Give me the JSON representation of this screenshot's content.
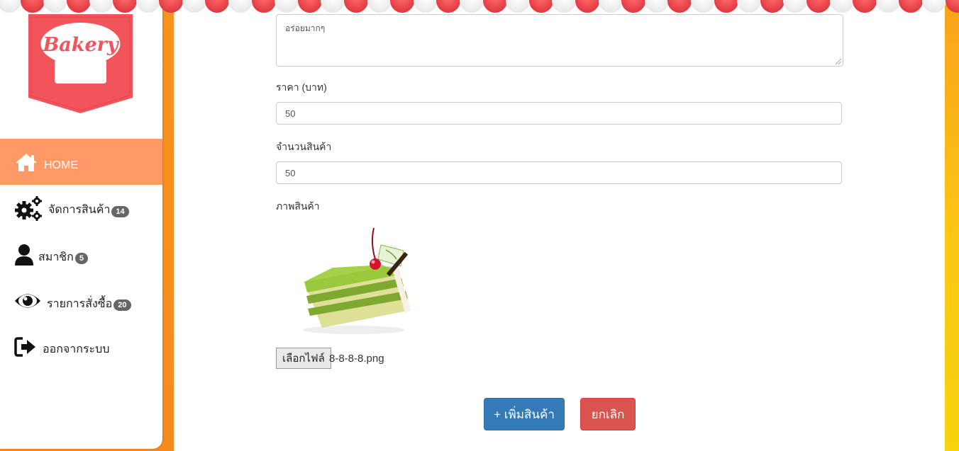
{
  "brand": {
    "logo_text": "Bakery",
    "logo_color": "#f2545b"
  },
  "colors": {
    "active_nav": "#ff9966",
    "add_button": "#337ab7",
    "cancel_button": "#d9534f",
    "badge": "#666666"
  },
  "sidebar": {
    "items": [
      {
        "label": "HOME",
        "icon": "home-icon",
        "badge": null
      },
      {
        "label": "จัดการสินค้า",
        "icon": "gears-icon",
        "badge": "14"
      },
      {
        "label": "สมาชิก",
        "icon": "user-icon",
        "badge": "5"
      },
      {
        "label": "รายการสั่งซื้อ",
        "icon": "eye-icon",
        "badge": "20"
      },
      {
        "label": "ออกจากระบบ",
        "icon": "sign-out-icon",
        "badge": null
      }
    ]
  },
  "form": {
    "detail_value": "อร่อยมากๆ",
    "price_label": "ราคา (บาท)",
    "price_value": "50",
    "qty_label": "จำนวนสินค้า",
    "qty_value": "50",
    "image_label": "ภาพสินค้า",
    "image_alt": "green tea cake slice",
    "file_button": "เลือกไฟล์",
    "file_name": "8-8-8-8.png"
  },
  "actions": {
    "add_label": "+ เพิ่มสินค้า",
    "cancel_label": "ยกเลิก"
  }
}
